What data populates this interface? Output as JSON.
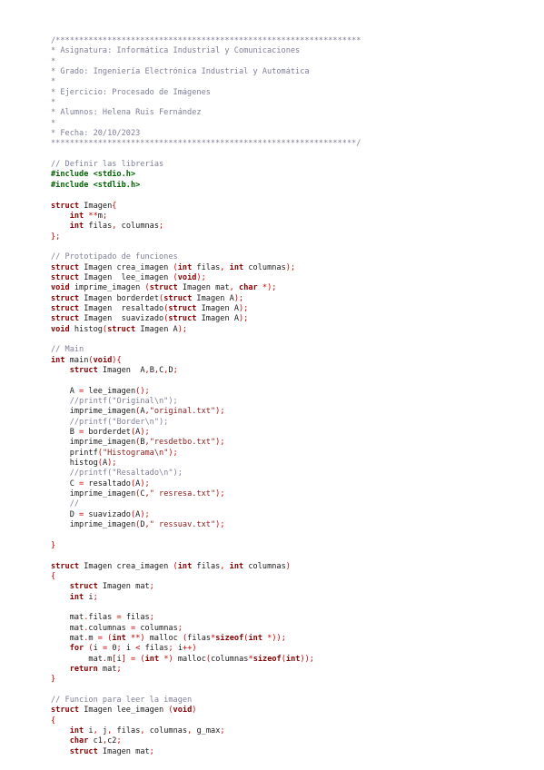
{
  "document": {
    "lines": [
      [
        [
          "comment",
          "/*****************************************************************"
        ]
      ],
      [
        [
          "comment",
          "* Asignatura: Informática Industrial y Comunicaciones"
        ]
      ],
      [
        [
          "comment",
          "*"
        ]
      ],
      [
        [
          "comment",
          "* Grado: Ingeniería Electrónica Industrial y Automática"
        ]
      ],
      [
        [
          "comment",
          "*"
        ]
      ],
      [
        [
          "comment",
          "* Ejercicio: Procesado de Imágenes"
        ]
      ],
      [
        [
          "comment",
          "*"
        ]
      ],
      [
        [
          "comment",
          "* Alumnos: Helena Ruis Fernández"
        ]
      ],
      [
        [
          "comment",
          "*"
        ]
      ],
      [
        [
          "comment",
          "* Fecha: 20/10/2023"
        ]
      ],
      [
        [
          "comment",
          "*****************************************************************/"
        ]
      ],
      [],
      [
        [
          "comment",
          "// Definir las librerías"
        ]
      ],
      [
        [
          "pre",
          "#include <stdio.h>"
        ]
      ],
      [
        [
          "pre",
          "#include <stdlib.h>"
        ]
      ],
      [],
      [
        [
          "keyword",
          "struct"
        ],
        [
          "plain",
          " Imagen"
        ],
        [
          "op",
          "{"
        ]
      ],
      [
        [
          "plain",
          "    "
        ],
        [
          "type",
          "int"
        ],
        [
          "plain",
          " "
        ],
        [
          "op",
          "**"
        ],
        [
          "plain",
          "m"
        ],
        [
          "op",
          ";"
        ]
      ],
      [
        [
          "plain",
          "    "
        ],
        [
          "type",
          "int"
        ],
        [
          "plain",
          " filas"
        ],
        [
          "op",
          ","
        ],
        [
          "plain",
          " columnas"
        ],
        [
          "op",
          ";"
        ]
      ],
      [
        [
          "op",
          "};"
        ]
      ],
      [],
      [
        [
          "comment",
          "// Prototipado de funciones"
        ]
      ],
      [
        [
          "keyword",
          "struct"
        ],
        [
          "plain",
          " Imagen crea_imagen "
        ],
        [
          "op",
          "("
        ],
        [
          "type",
          "int"
        ],
        [
          "plain",
          " filas"
        ],
        [
          "op",
          ","
        ],
        [
          "plain",
          " "
        ],
        [
          "type",
          "int"
        ],
        [
          "plain",
          " columnas"
        ],
        [
          "op",
          ");"
        ]
      ],
      [
        [
          "keyword",
          "struct"
        ],
        [
          "plain",
          " Imagen  lee_imagen "
        ],
        [
          "op",
          "("
        ],
        [
          "type",
          "void"
        ],
        [
          "op",
          ");"
        ]
      ],
      [
        [
          "type",
          "void"
        ],
        [
          "plain",
          " imprime_imagen "
        ],
        [
          "op",
          "("
        ],
        [
          "keyword",
          "struct"
        ],
        [
          "plain",
          " Imagen mat"
        ],
        [
          "op",
          ","
        ],
        [
          "plain",
          " "
        ],
        [
          "type",
          "char"
        ],
        [
          "plain",
          " "
        ],
        [
          "op",
          "*);"
        ]
      ],
      [
        [
          "keyword",
          "struct"
        ],
        [
          "plain",
          " Imagen borderdet"
        ],
        [
          "op",
          "("
        ],
        [
          "keyword",
          "struct"
        ],
        [
          "plain",
          " Imagen A"
        ],
        [
          "op",
          ");"
        ]
      ],
      [
        [
          "keyword",
          "struct"
        ],
        [
          "plain",
          " Imagen  resaltado"
        ],
        [
          "op",
          "("
        ],
        [
          "keyword",
          "struct"
        ],
        [
          "plain",
          " Imagen A"
        ],
        [
          "op",
          ");"
        ]
      ],
      [
        [
          "keyword",
          "struct"
        ],
        [
          "plain",
          " Imagen  suavizado"
        ],
        [
          "op",
          "("
        ],
        [
          "keyword",
          "struct"
        ],
        [
          "plain",
          " Imagen A"
        ],
        [
          "op",
          ");"
        ]
      ],
      [
        [
          "type",
          "void"
        ],
        [
          "plain",
          " histog"
        ],
        [
          "op",
          "("
        ],
        [
          "keyword",
          "struct"
        ],
        [
          "plain",
          " Imagen A"
        ],
        [
          "op",
          ");"
        ]
      ],
      [],
      [
        [
          "comment",
          "// Main"
        ]
      ],
      [
        [
          "type",
          "int"
        ],
        [
          "plain",
          " main"
        ],
        [
          "op",
          "("
        ],
        [
          "type",
          "void"
        ],
        [
          "op",
          "){"
        ]
      ],
      [
        [
          "plain",
          "    "
        ],
        [
          "keyword",
          "struct"
        ],
        [
          "plain",
          " Imagen  A"
        ],
        [
          "op",
          ","
        ],
        [
          "plain",
          "B"
        ],
        [
          "op",
          ","
        ],
        [
          "plain",
          "C"
        ],
        [
          "op",
          ","
        ],
        [
          "plain",
          "D"
        ],
        [
          "op",
          ";"
        ]
      ],
      [],
      [
        [
          "plain",
          "    A "
        ],
        [
          "op",
          "="
        ],
        [
          "plain",
          " lee_imagen"
        ],
        [
          "op",
          "();"
        ]
      ],
      [
        [
          "plain",
          "    "
        ],
        [
          "comment",
          "//printf(\"Original\\n\");"
        ]
      ],
      [
        [
          "plain",
          "    imprime_imagen"
        ],
        [
          "op",
          "("
        ],
        [
          "plain",
          "A"
        ],
        [
          "op",
          ","
        ],
        [
          "string",
          "\"original.txt\""
        ],
        [
          "op",
          ");"
        ]
      ],
      [
        [
          "plain",
          "    "
        ],
        [
          "comment",
          "//printf(\"Border\\n\");"
        ]
      ],
      [
        [
          "plain",
          "    B "
        ],
        [
          "op",
          "="
        ],
        [
          "plain",
          " borderdet"
        ],
        [
          "op",
          "("
        ],
        [
          "plain",
          "A"
        ],
        [
          "op",
          ");"
        ]
      ],
      [
        [
          "plain",
          "    imprime_imagen"
        ],
        [
          "op",
          "("
        ],
        [
          "plain",
          "B"
        ],
        [
          "op",
          ","
        ],
        [
          "string",
          "\"resdetbo.txt\""
        ],
        [
          "op",
          ");"
        ]
      ],
      [
        [
          "plain",
          "    printf"
        ],
        [
          "op",
          "("
        ],
        [
          "string",
          "\"Histograma\\n\""
        ],
        [
          "op",
          ");"
        ]
      ],
      [
        [
          "plain",
          "    histog"
        ],
        [
          "op",
          "("
        ],
        [
          "plain",
          "A"
        ],
        [
          "op",
          ");"
        ]
      ],
      [
        [
          "plain",
          "    "
        ],
        [
          "comment",
          "//printf(\"Resaltado\\n\");"
        ]
      ],
      [
        [
          "plain",
          "    C "
        ],
        [
          "op",
          "="
        ],
        [
          "plain",
          " resaltado"
        ],
        [
          "op",
          "("
        ],
        [
          "plain",
          "A"
        ],
        [
          "op",
          ");"
        ]
      ],
      [
        [
          "plain",
          "    imprime_imagen"
        ],
        [
          "op",
          "("
        ],
        [
          "plain",
          "C"
        ],
        [
          "op",
          ","
        ],
        [
          "string",
          "\" resresa.txt\""
        ],
        [
          "op",
          ");"
        ]
      ],
      [
        [
          "plain",
          "    "
        ],
        [
          "comment",
          "//"
        ]
      ],
      [
        [
          "plain",
          "    D "
        ],
        [
          "op",
          "="
        ],
        [
          "plain",
          " suavizado"
        ],
        [
          "op",
          "("
        ],
        [
          "plain",
          "A"
        ],
        [
          "op",
          ");"
        ]
      ],
      [
        [
          "plain",
          "    imprime_imagen"
        ],
        [
          "op",
          "("
        ],
        [
          "plain",
          "D"
        ],
        [
          "op",
          ","
        ],
        [
          "string",
          "\" ressuav.txt\""
        ],
        [
          "op",
          ");"
        ]
      ],
      [],
      [
        [
          "op",
          "}"
        ]
      ],
      [],
      [
        [
          "keyword",
          "struct"
        ],
        [
          "plain",
          " Imagen crea_imagen "
        ],
        [
          "op",
          "("
        ],
        [
          "type",
          "int"
        ],
        [
          "plain",
          " filas"
        ],
        [
          "op",
          ","
        ],
        [
          "plain",
          " "
        ],
        [
          "type",
          "int"
        ],
        [
          "plain",
          " columnas"
        ],
        [
          "op",
          ")"
        ]
      ],
      [
        [
          "op",
          "{"
        ]
      ],
      [
        [
          "plain",
          "    "
        ],
        [
          "keyword",
          "struct"
        ],
        [
          "plain",
          " Imagen mat"
        ],
        [
          "op",
          ";"
        ]
      ],
      [
        [
          "plain",
          "    "
        ],
        [
          "type",
          "int"
        ],
        [
          "plain",
          " i"
        ],
        [
          "op",
          ";"
        ]
      ],
      [],
      [
        [
          "plain",
          "    mat"
        ],
        [
          "op",
          "."
        ],
        [
          "plain",
          "filas "
        ],
        [
          "op",
          "="
        ],
        [
          "plain",
          " filas"
        ],
        [
          "op",
          ";"
        ]
      ],
      [
        [
          "plain",
          "    mat"
        ],
        [
          "op",
          "."
        ],
        [
          "plain",
          "columnas "
        ],
        [
          "op",
          "="
        ],
        [
          "plain",
          " columnas"
        ],
        [
          "op",
          ";"
        ]
      ],
      [
        [
          "plain",
          "    mat"
        ],
        [
          "op",
          "."
        ],
        [
          "plain",
          "m "
        ],
        [
          "op",
          "="
        ],
        [
          "plain",
          " "
        ],
        [
          "op",
          "("
        ],
        [
          "type",
          "int"
        ],
        [
          "plain",
          " "
        ],
        [
          "op",
          "**)"
        ],
        [
          "plain",
          " malloc "
        ],
        [
          "op",
          "("
        ],
        [
          "plain",
          "filas"
        ],
        [
          "op",
          "*"
        ],
        [
          "keyword",
          "sizeof"
        ],
        [
          "op",
          "("
        ],
        [
          "type",
          "int"
        ],
        [
          "plain",
          " "
        ],
        [
          "op",
          "*));"
        ]
      ],
      [
        [
          "plain",
          "    "
        ],
        [
          "keyword",
          "for"
        ],
        [
          "plain",
          " "
        ],
        [
          "op",
          "("
        ],
        [
          "plain",
          "i "
        ],
        [
          "op",
          "="
        ],
        [
          "plain",
          " 0"
        ],
        [
          "op",
          ";"
        ],
        [
          "plain",
          " i "
        ],
        [
          "op",
          "<"
        ],
        [
          "plain",
          " filas"
        ],
        [
          "op",
          ";"
        ],
        [
          "plain",
          " i"
        ],
        [
          "op",
          "++)"
        ]
      ],
      [
        [
          "plain",
          "        mat"
        ],
        [
          "op",
          "."
        ],
        [
          "plain",
          "m"
        ],
        [
          "op",
          "["
        ],
        [
          "plain",
          "i"
        ],
        [
          "op",
          "]"
        ],
        [
          "plain",
          " "
        ],
        [
          "op",
          "="
        ],
        [
          "plain",
          " "
        ],
        [
          "op",
          "("
        ],
        [
          "type",
          "int"
        ],
        [
          "plain",
          " "
        ],
        [
          "op",
          "*)"
        ],
        [
          "plain",
          " malloc"
        ],
        [
          "op",
          "("
        ],
        [
          "plain",
          "columnas"
        ],
        [
          "op",
          "*"
        ],
        [
          "keyword",
          "sizeof"
        ],
        [
          "op",
          "("
        ],
        [
          "type",
          "int"
        ],
        [
          "op",
          "));"
        ]
      ],
      [
        [
          "plain",
          "    "
        ],
        [
          "keyword",
          "return"
        ],
        [
          "plain",
          " mat"
        ],
        [
          "op",
          ";"
        ]
      ],
      [
        [
          "op",
          "}"
        ]
      ],
      [],
      [
        [
          "comment",
          "// Funcion para leer la imagen"
        ]
      ],
      [
        [
          "keyword",
          "struct"
        ],
        [
          "plain",
          " Imagen lee_imagen "
        ],
        [
          "op",
          "("
        ],
        [
          "type",
          "void"
        ],
        [
          "op",
          ")"
        ]
      ],
      [
        [
          "op",
          "{"
        ]
      ],
      [
        [
          "plain",
          "    "
        ],
        [
          "type",
          "int"
        ],
        [
          "plain",
          " i"
        ],
        [
          "op",
          ","
        ],
        [
          "plain",
          " j"
        ],
        [
          "op",
          ","
        ],
        [
          "plain",
          " filas"
        ],
        [
          "op",
          ","
        ],
        [
          "plain",
          " columnas"
        ],
        [
          "op",
          ","
        ],
        [
          "plain",
          " g_max"
        ],
        [
          "op",
          ";"
        ]
      ],
      [
        [
          "plain",
          "    "
        ],
        [
          "type",
          "char"
        ],
        [
          "plain",
          " c1"
        ],
        [
          "op",
          ","
        ],
        [
          "plain",
          "c2"
        ],
        [
          "op",
          ";"
        ]
      ],
      [
        [
          "plain",
          "    "
        ],
        [
          "keyword",
          "struct"
        ],
        [
          "plain",
          " Imagen mat"
        ],
        [
          "op",
          ";"
        ]
      ]
    ]
  }
}
